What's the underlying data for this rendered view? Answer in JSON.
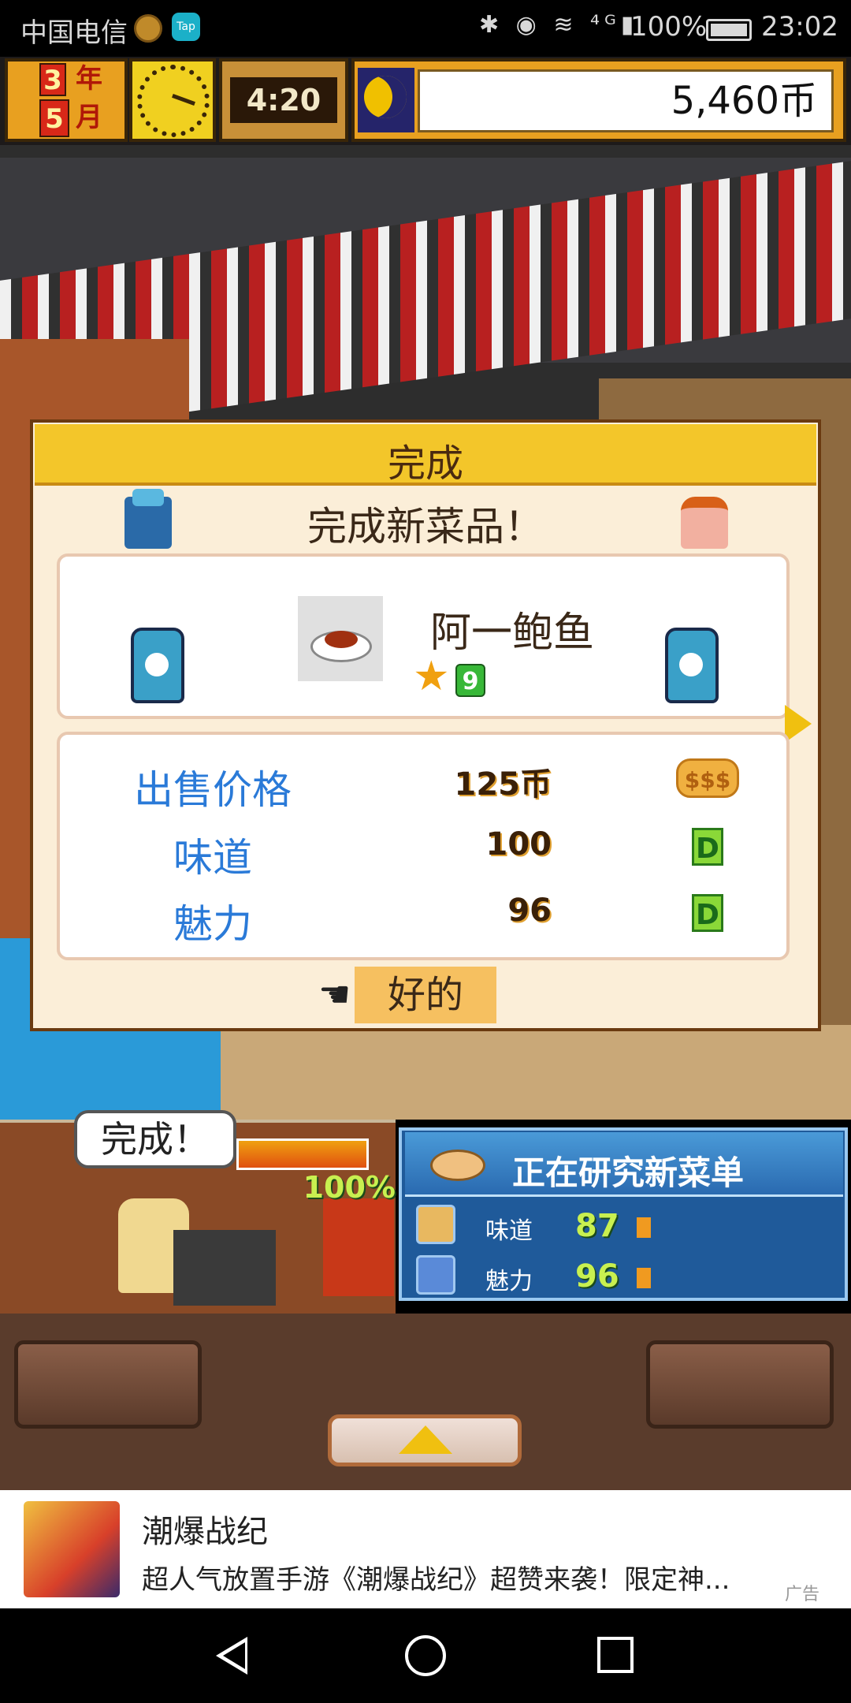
{
  "status_bar": {
    "carrier": "中国电信",
    "tap_badge": "Tap",
    "sys_icons": "✱ ◉ ≋ ⁴ᴳ▮",
    "battery_pct": "100%",
    "time": "23:02"
  },
  "hud": {
    "year_num": "3",
    "year_unit": "年",
    "month_num": "5",
    "month_unit": "月",
    "game_time": "4:20",
    "money": "5,460币"
  },
  "dialog": {
    "title": "完成",
    "headline": "完成新菜品！",
    "dish_name": "阿一鲍鱼",
    "rank": "9",
    "stats": [
      {
        "label": "出售价格",
        "value": "125币",
        "grade": "$$$"
      },
      {
        "label": "味道",
        "value": "100",
        "grade": "D"
      },
      {
        "label": "魅力",
        "value": "96",
        "grade": "D"
      }
    ],
    "ok_label": "好的"
  },
  "kitchen": {
    "speech": "完成！",
    "progress_label": "100%",
    "progress_value": 1.0
  },
  "research": {
    "title": "正在研究新菜单",
    "rows": [
      {
        "label": "味道",
        "value": "87"
      },
      {
        "label": "魅力",
        "value": "96"
      }
    ]
  },
  "ad": {
    "title": "潮爆战纪",
    "description": "超人气放置手游《潮爆战纪》超赞来袭！限定神...",
    "mark": "广告"
  },
  "colors": {
    "accent_gold": "#f3c62a",
    "stat_blue": "#2a7ad8",
    "research_blue": "#1f5a9a"
  }
}
